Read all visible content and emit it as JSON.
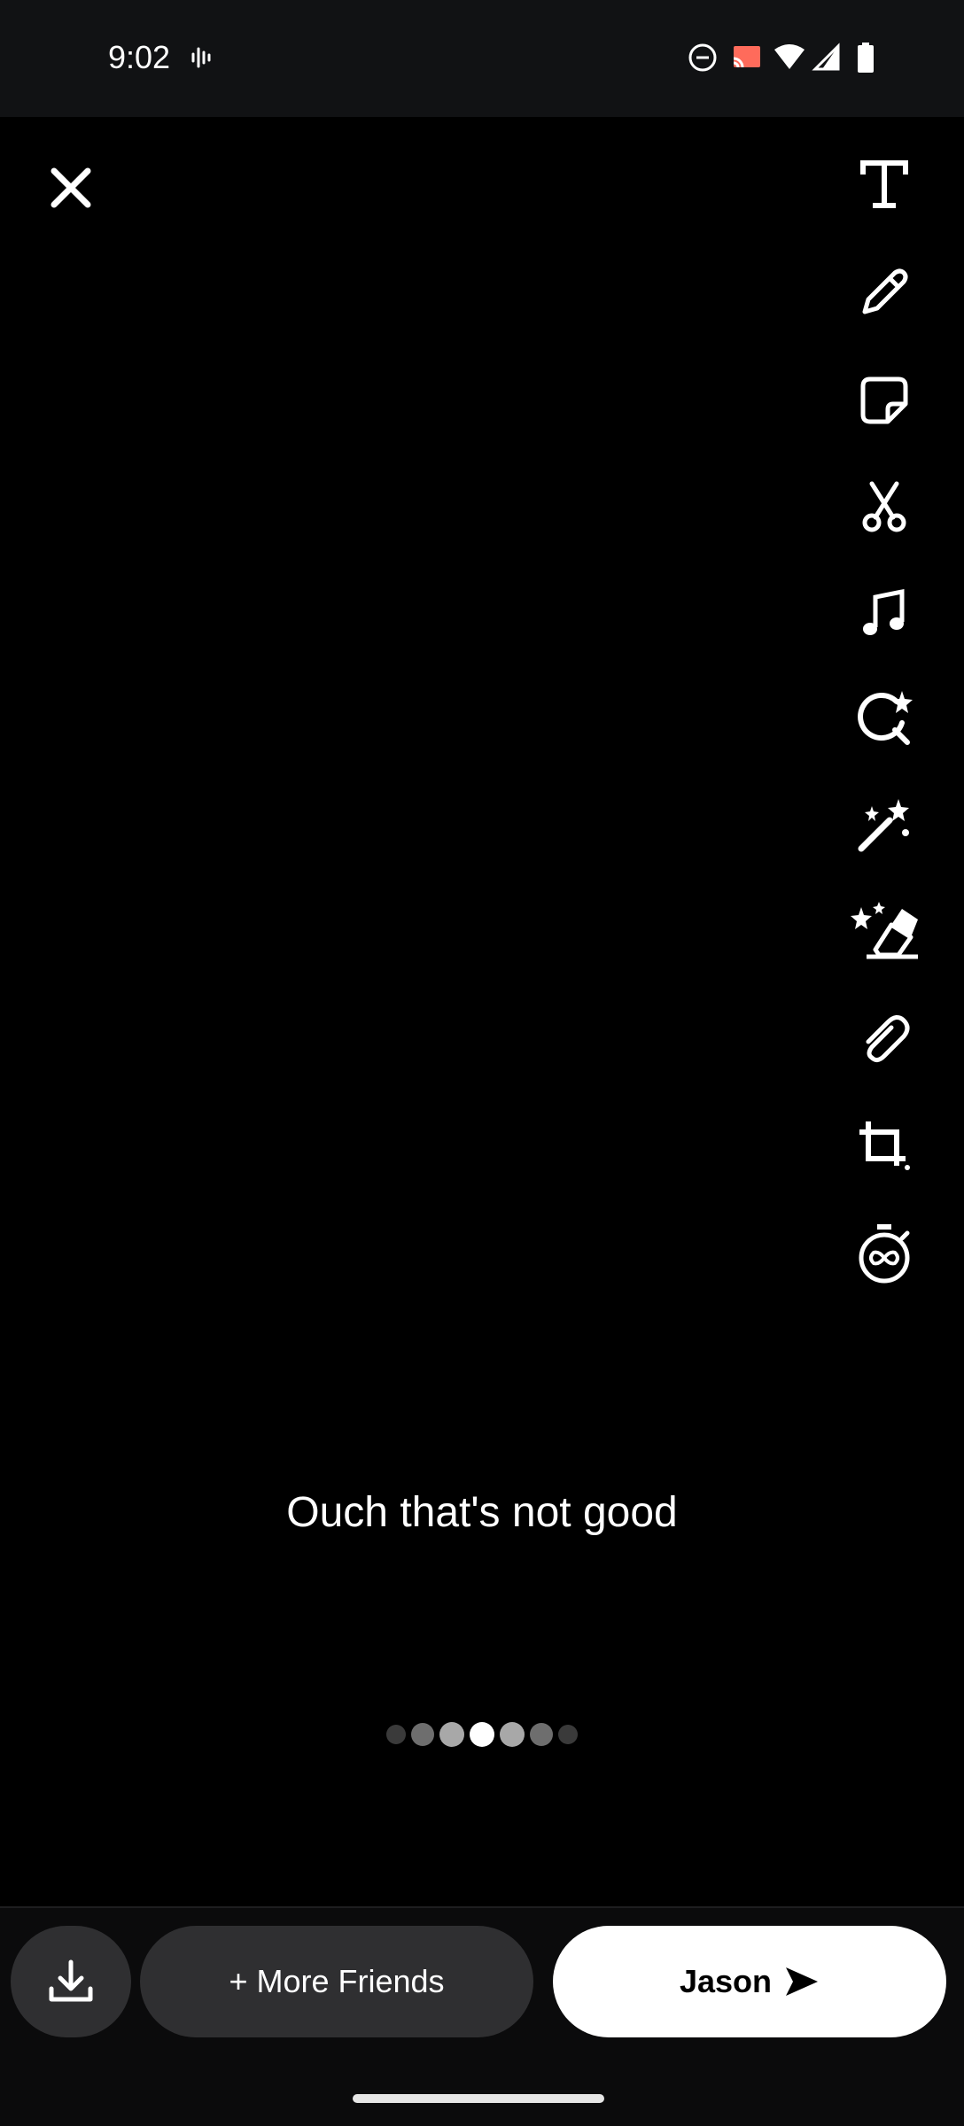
{
  "status_bar": {
    "time": "9:02",
    "icons": [
      "voicemail-icon",
      "dnd-icon",
      "cast-icon",
      "wifi-icon",
      "signal-icon",
      "battery-icon"
    ]
  },
  "editor": {
    "close_icon": "close-icon",
    "tools": [
      {
        "name": "text-tool",
        "icon": "text-icon"
      },
      {
        "name": "draw-tool",
        "icon": "pencil-icon"
      },
      {
        "name": "sticker-tool",
        "icon": "sticker-icon"
      },
      {
        "name": "scissors-tool",
        "icon": "scissors-icon"
      },
      {
        "name": "music-tool",
        "icon": "music-icon"
      },
      {
        "name": "lens-search-tool",
        "icon": "lens-search-icon"
      },
      {
        "name": "magic-tool",
        "icon": "magic-wand-icon"
      },
      {
        "name": "eraser-tool",
        "icon": "magic-eraser-icon"
      },
      {
        "name": "attachment-tool",
        "icon": "paperclip-icon"
      },
      {
        "name": "crop-tool",
        "icon": "crop-icon"
      },
      {
        "name": "timer-tool",
        "icon": "infinity-timer-icon"
      }
    ],
    "caption": "Ouch that's not good",
    "page_dots": {
      "count": 7,
      "active_index": 3
    }
  },
  "bottom_bar": {
    "download_icon": "download-icon",
    "more_friends_label": "+ More Friends",
    "send_label": "Jason",
    "send_icon": "send-arrow-icon"
  }
}
